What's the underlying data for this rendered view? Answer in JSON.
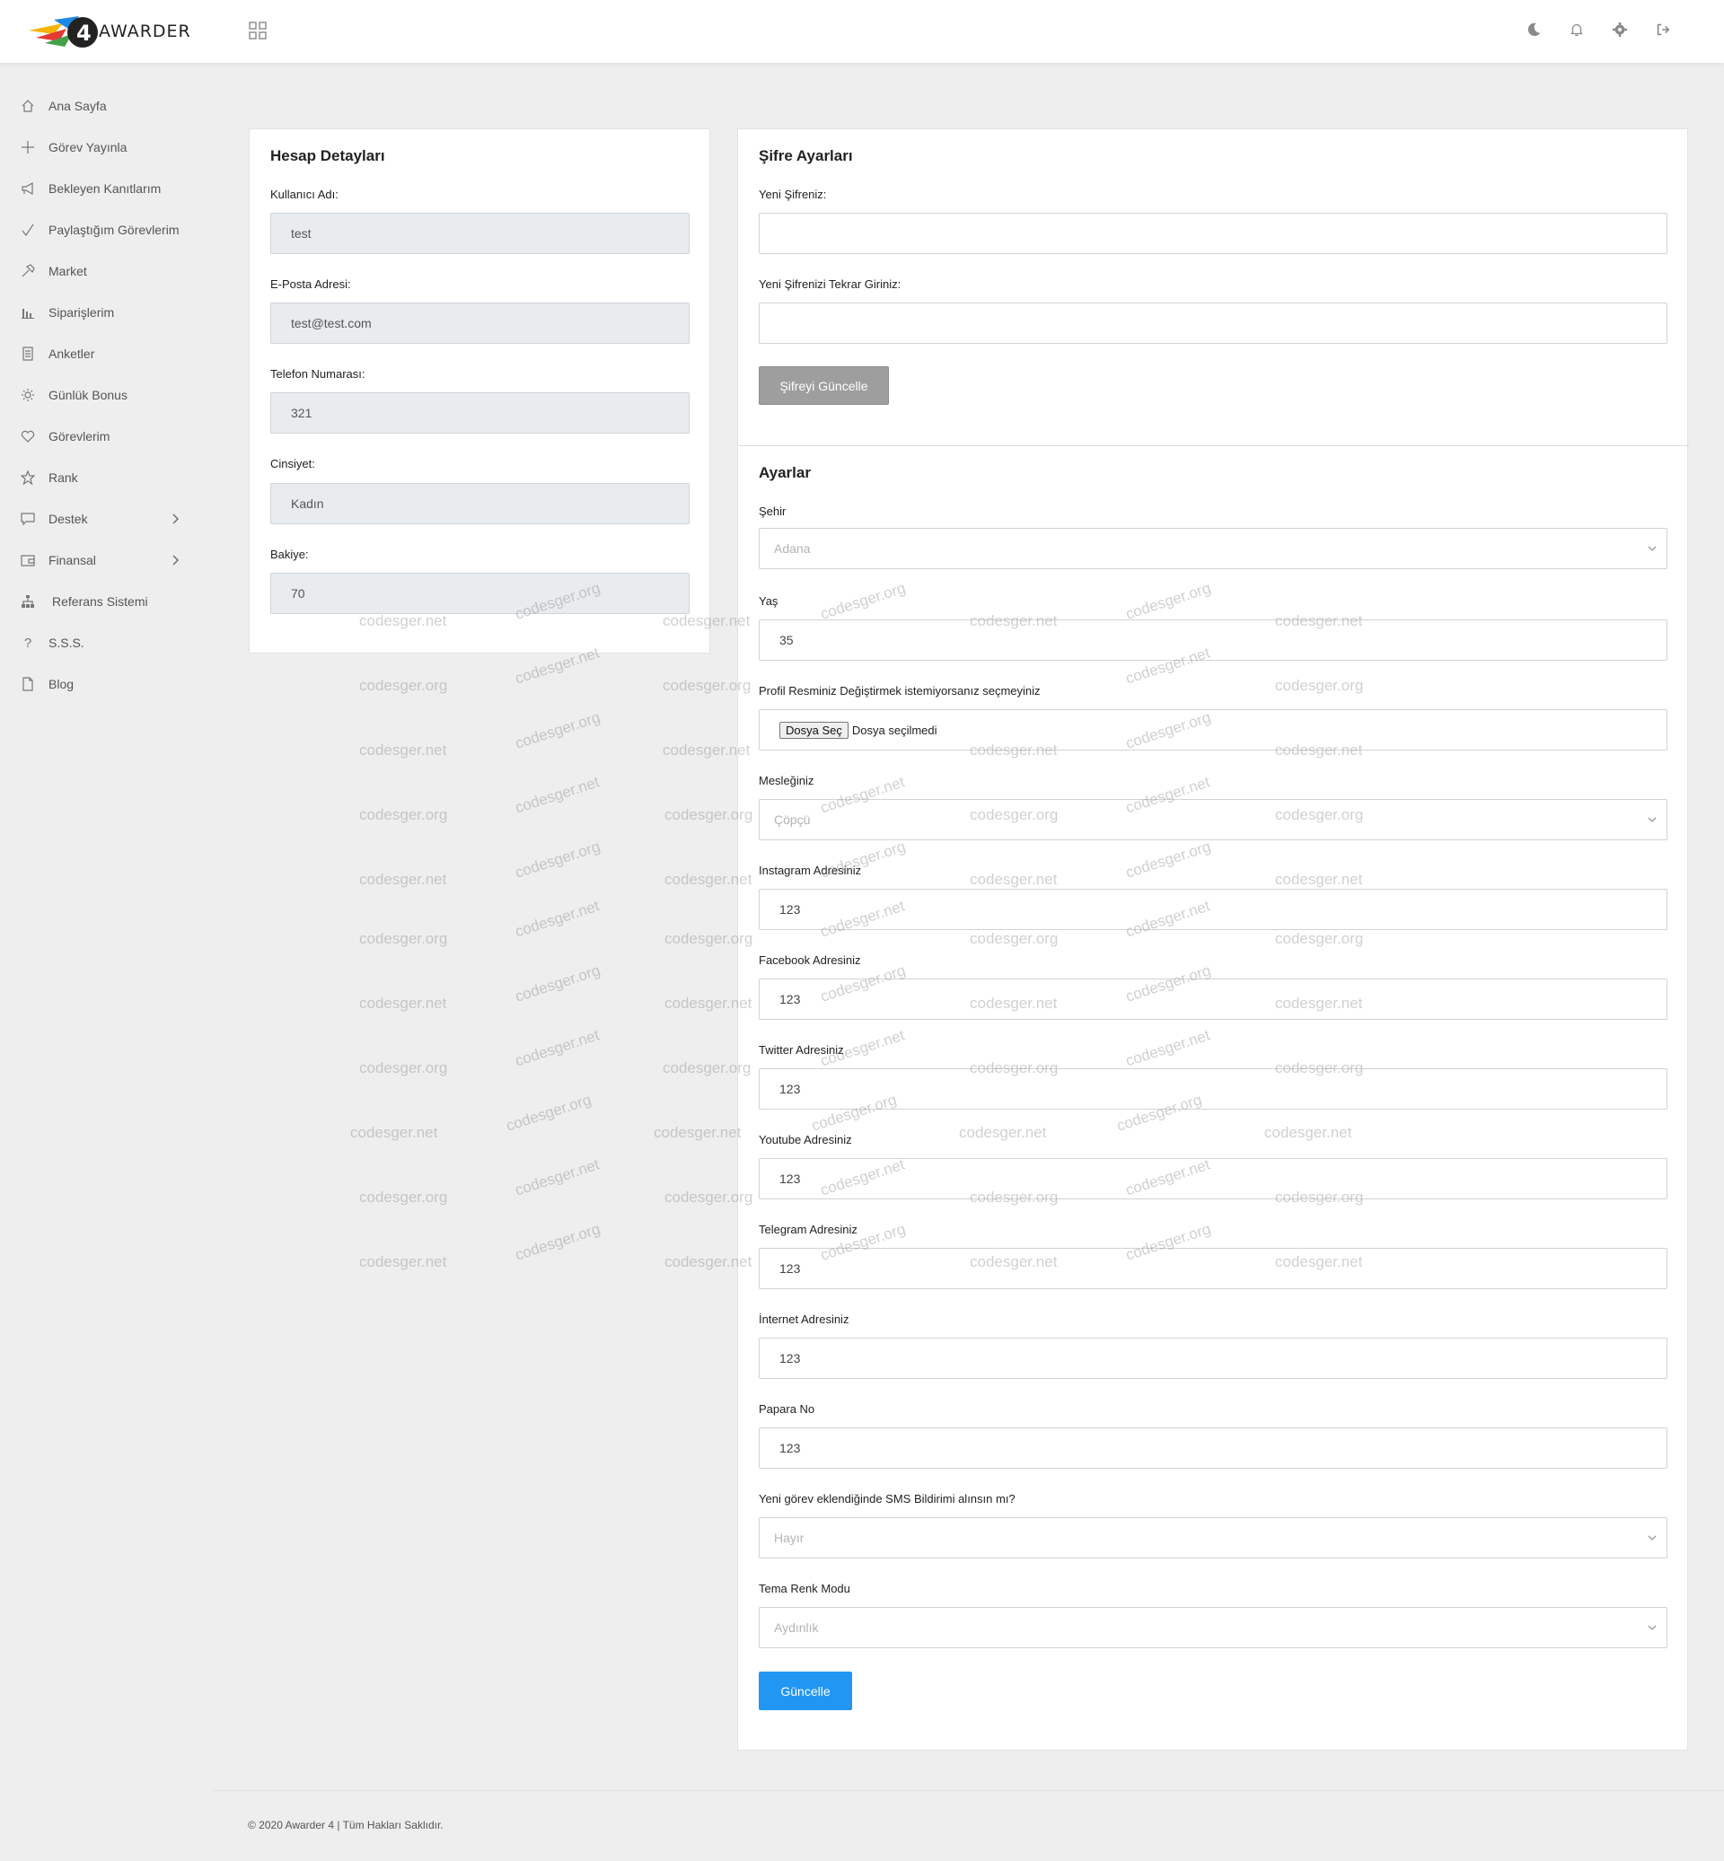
{
  "brand": {
    "name": "AWARDER"
  },
  "sidebar": {
    "items": [
      {
        "label": "Ana Sayfa",
        "icon": "home-icon"
      },
      {
        "label": "Görev Yayınla",
        "icon": "plus-icon"
      },
      {
        "label": "Bekleyen Kanıtlarım",
        "icon": "megaphone-icon"
      },
      {
        "label": "Paylaştığım Görevlerim",
        "icon": "check-icon"
      },
      {
        "label": "Market",
        "icon": "hammer-icon"
      },
      {
        "label": "Siparişlerim",
        "icon": "bar-chart-icon"
      },
      {
        "label": "Anketler",
        "icon": "document-list-icon"
      },
      {
        "label": "Günlük Bonus",
        "icon": "sun-icon"
      },
      {
        "label": "Görevlerim",
        "icon": "heart-icon"
      },
      {
        "label": "Rank",
        "icon": "star-icon"
      },
      {
        "label": "Destek",
        "icon": "chat-icon",
        "has_children": true
      },
      {
        "label": "Finansal",
        "icon": "wallet-icon",
        "has_children": true
      },
      {
        "label": "Referans Sistemi",
        "icon": "sitemap-icon"
      },
      {
        "label": "S.S.S.",
        "icon": "question-icon"
      },
      {
        "label": "Blog",
        "icon": "file-icon"
      }
    ]
  },
  "account": {
    "title": "Hesap Detayları",
    "username_label": "Kullanıcı Adı:",
    "username": "test",
    "email_label": "E-Posta Adresi:",
    "email": "test@test.com",
    "phone_label": "Telefon Numarası:",
    "phone": "321",
    "gender_label": "Cinsiyet:",
    "gender": "Kadın",
    "balance_label": "Bakiye:",
    "balance": "70"
  },
  "password": {
    "title": "Şifre Ayarları",
    "new_label": "Yeni Şifreniz:",
    "repeat_label": "Yeni Şifrenizi Tekrar Giriniz:",
    "button": "Şifreyi Güncelle"
  },
  "settings": {
    "title": "Ayarlar",
    "city_label": "Şehir",
    "city": "Adana",
    "age_label": "Yaş",
    "age": "35",
    "photo_label": "Profil Resminiz Değiştirmek istemiyorsanız seçmeyiniz",
    "file_button": "Dosya Seç",
    "file_status": "Dosya seçilmedi",
    "job_label": "Mesleğiniz",
    "job": "Çöpçü",
    "instagram_label": "Instagram Adresiniz",
    "instagram": "123",
    "facebook_label": "Facebook Adresiniz",
    "facebook": "123",
    "twitter_label": "Twitter Adresiniz",
    "twitter": "123",
    "youtube_label": "Youtube Adresiniz",
    "youtube": "123",
    "telegram_label": "Telegram Adresiniz",
    "telegram": "123",
    "internet_label": "İnternet Adresiniz",
    "internet": "123",
    "papara_label": "Papara No",
    "papara": "123",
    "sms_label": "Yeni görev eklendiğinde SMS Bildirimi alınsın mı?",
    "sms": "Hayır",
    "theme_label": "Tema Renk Modu",
    "theme": "Aydınlık",
    "button": "Güncelle"
  },
  "footer": {
    "text": "© 2020 Awarder 4 | Tüm Hakları Saklıdır."
  },
  "watermark": {
    "net": "codesger.net",
    "org": "codesger.org"
  },
  "colors": {
    "accent": "#2196f3",
    "gray_button": "#9e9e9e",
    "background": "#eeeeee"
  }
}
